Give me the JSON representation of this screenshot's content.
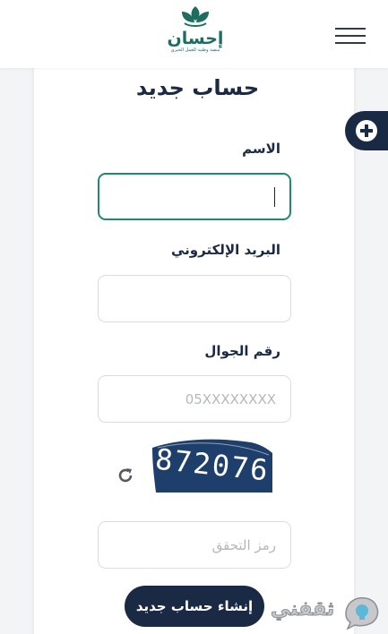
{
  "header": {
    "logo_name": "إحسان",
    "logo_tagline": "منصة وطنية للعمل الخيري"
  },
  "form": {
    "title": "حساب جديد",
    "name_label": "الاسم",
    "name_value": "",
    "email_label": "البريد الإلكتروني",
    "email_value": "",
    "phone_label": "رقم الجوال",
    "phone_placeholder": "05XXXXXXXX",
    "captcha_text": "872076",
    "captcha_placeholder": "رمز التحقق",
    "submit_label": "إنشاء حساب جديد"
  },
  "watermark": {
    "text": "ثقفني"
  },
  "colors": {
    "primary": "#1b2a44",
    "accent": "#1d8a72",
    "brand_green": "#1d6e60",
    "captcha_bg": "#1e3f6b"
  },
  "icons": [
    "menu-icon",
    "plus-icon",
    "refresh-icon",
    "bulb-icon"
  ]
}
